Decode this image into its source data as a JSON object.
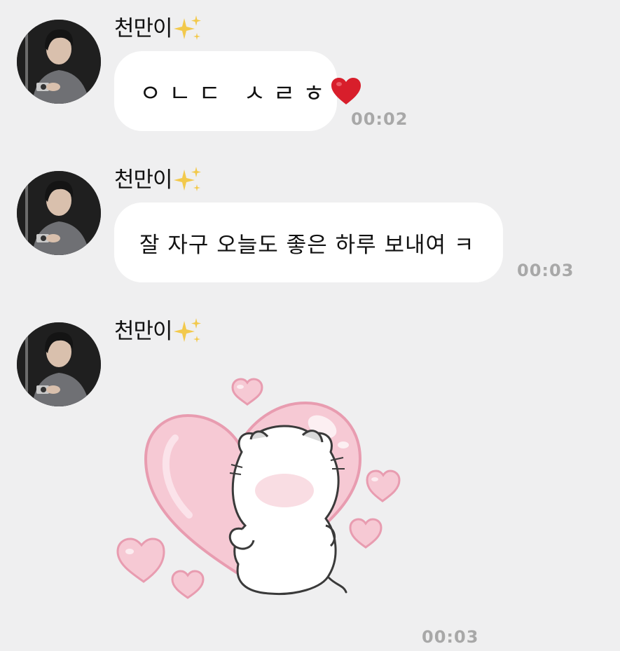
{
  "messages": [
    {
      "sender": "천만이",
      "sender_emoji": "sparkles-icon",
      "text": "ㅇㄴㄷ ㅅㄹㅎ",
      "emoji": "red-heart-icon",
      "time": "00:02"
    },
    {
      "sender": "천만이",
      "sender_emoji": "sparkles-icon",
      "text": "잘 자구 오늘도 좋은 하루 보내여 ㅋ",
      "time": "00:03"
    },
    {
      "sender": "천만이",
      "sender_emoji": "sparkles-icon",
      "sticker": "cat-hugging-heart-sticker",
      "time": "00:03"
    }
  ],
  "colors": {
    "background": "#efeff0",
    "bubble": "#ffffff",
    "timestamp": "#a8a8a8",
    "heart": "#d81e2b",
    "sticker_heart": "#f6c9d4"
  }
}
